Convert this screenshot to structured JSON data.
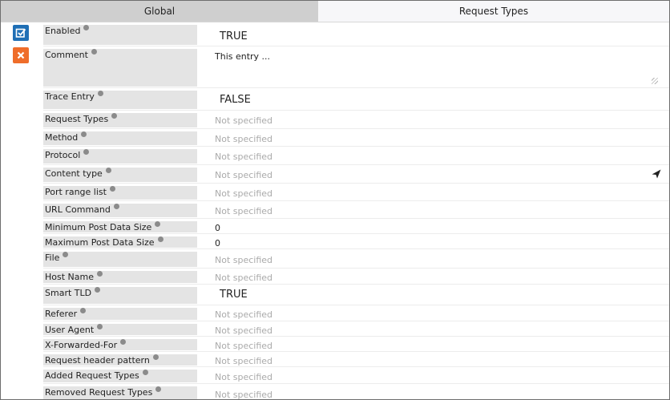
{
  "tabs": [
    {
      "label": "Global"
    },
    {
      "label": "Request Types"
    }
  ],
  "side_buttons": {
    "save_icon": "check-square-icon",
    "delete_icon": "close-icon"
  },
  "fields": [
    {
      "label": "Enabled",
      "value": "TRUE"
    },
    {
      "label": "Comment",
      "value": "This entry ..."
    },
    {
      "label": "Trace Entry",
      "value": "FALSE"
    },
    {
      "label": "Request Types",
      "value": "Not specified"
    },
    {
      "label": "Method",
      "value": "Not specified"
    },
    {
      "label": "Protocol",
      "value": "Not specified"
    },
    {
      "label": "Content type",
      "value": "Not specified"
    },
    {
      "label": "Port range list",
      "value": "Not specified"
    },
    {
      "label": "URL Command",
      "value": "Not specified"
    },
    {
      "label": "Minimum Post Data Size",
      "value": "0"
    },
    {
      "label": "Maximum Post Data Size",
      "value": "0"
    },
    {
      "label": "File",
      "value": "Not specified"
    },
    {
      "label": "Host Name",
      "value": "Not specified"
    },
    {
      "label": "Smart TLD",
      "value": "TRUE"
    },
    {
      "label": "Referer",
      "value": "Not specified"
    },
    {
      "label": "User Agent",
      "value": "Not specified"
    },
    {
      "label": "X-Forwarded-For",
      "value": "Not specified"
    },
    {
      "label": "Request header pattern",
      "value": "Not specified"
    },
    {
      "label": "Added Request Types",
      "value": "Not specified"
    },
    {
      "label": "Removed Request Types",
      "value": "Not specified"
    }
  ]
}
